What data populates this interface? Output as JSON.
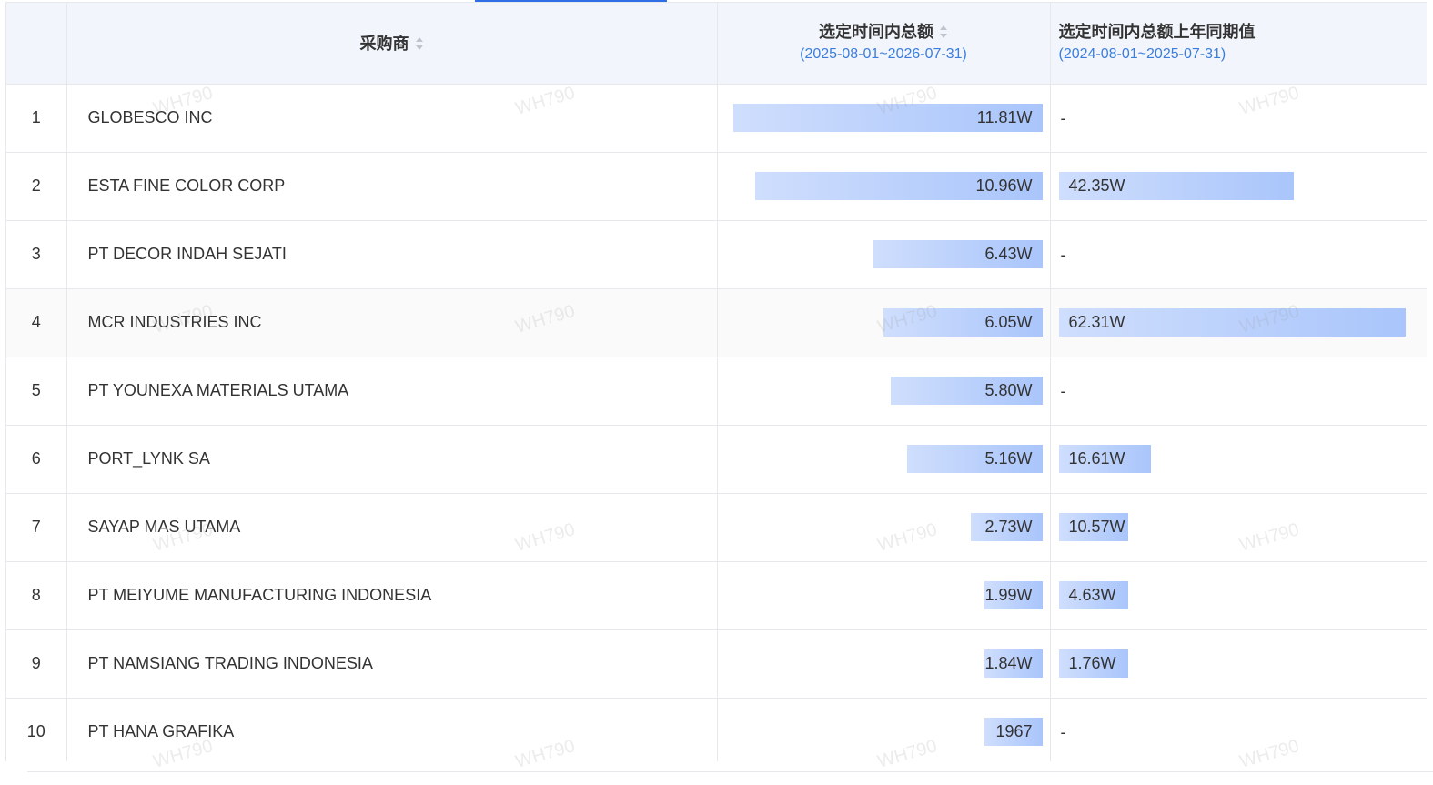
{
  "table": {
    "columns": {
      "index": "",
      "buyer": "采购商",
      "current_total": "选定时间内总额",
      "current_range": "(2025-08-01~2026-07-31)",
      "prev_total": "选定时间内总额上年同期值",
      "prev_range": "(2024-08-01~2025-07-31)"
    },
    "rows": [
      {
        "index": "1",
        "buyer": "GLOBESCO INC",
        "current": "11.81W",
        "current_value": 118100,
        "prev": "-",
        "prev_value": null
      },
      {
        "index": "2",
        "buyer": "ESTA FINE COLOR CORP",
        "current": "10.96W",
        "current_value": 109600,
        "prev": "42.35W",
        "prev_value": 423500
      },
      {
        "index": "3",
        "buyer": "PT DECOR INDAH SEJATI",
        "current": "6.43W",
        "current_value": 64300,
        "prev": "-",
        "prev_value": null
      },
      {
        "index": "4",
        "buyer": "MCR INDUSTRIES INC",
        "current": "6.05W",
        "current_value": 60500,
        "prev": "62.31W",
        "prev_value": 623100
      },
      {
        "index": "5",
        "buyer": "PT YOUNEXA MATERIALS UTAMA",
        "current": "5.80W",
        "current_value": 58000,
        "prev": "-",
        "prev_value": null
      },
      {
        "index": "6",
        "buyer": "PORT_LYNK SA",
        "current": "5.16W",
        "current_value": 51600,
        "prev": "16.61W",
        "prev_value": 166100
      },
      {
        "index": "7",
        "buyer": "SAYAP MAS UTAMA",
        "current": "2.73W",
        "current_value": 27300,
        "prev": "10.57W",
        "prev_value": 105700
      },
      {
        "index": "8",
        "buyer": "PT MEIYUME MANUFACTURING INDONESIA",
        "current": "1.99W",
        "current_value": 19900,
        "prev": "4.63W",
        "prev_value": 46300
      },
      {
        "index": "9",
        "buyer": "PT NAMSIANG TRADING INDONESIA",
        "current": "1.84W",
        "current_value": 18400,
        "prev": "1.76W",
        "prev_value": 17600
      },
      {
        "index": "10",
        "buyer": "PT HANA GRAFIKA",
        "current": "1967",
        "current_value": 1967,
        "prev": "-",
        "prev_value": null
      }
    ],
    "hovered_row": 4
  },
  "watermark": "WH790",
  "colors": {
    "header_bg": "#f2f6fc",
    "bar_start": "#cfdefd",
    "bar_end": "#a9c5fb",
    "range_text": "#3b7ddd",
    "tab_indicator": "#2f6fe6"
  }
}
